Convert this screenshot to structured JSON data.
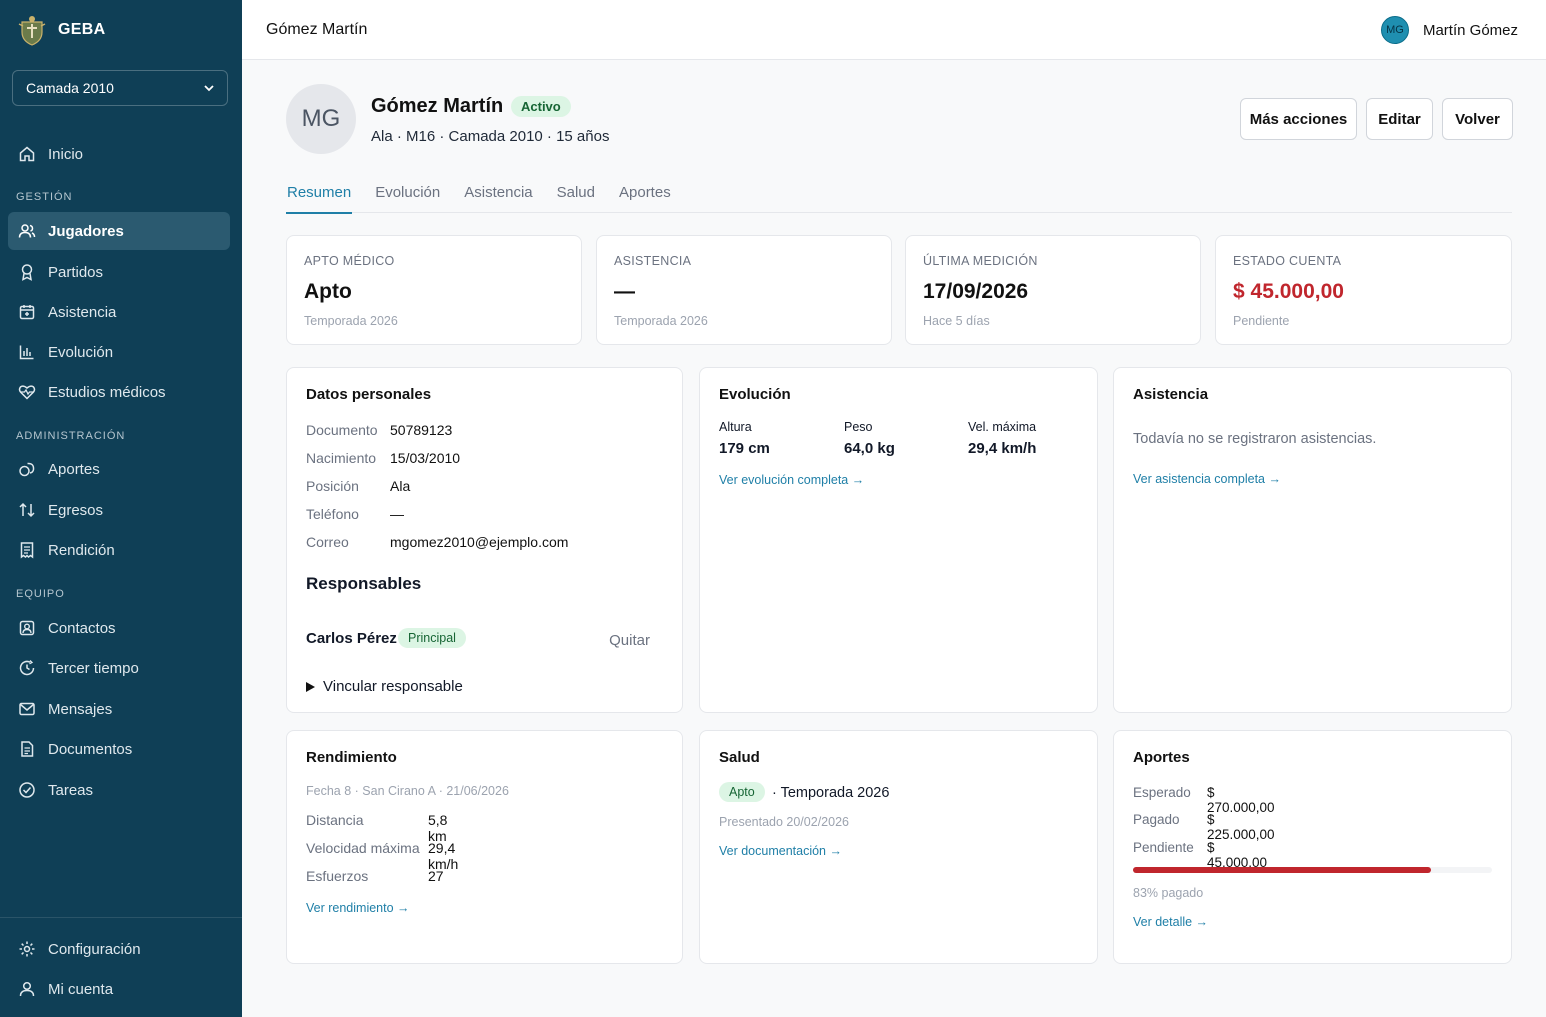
{
  "brand": {
    "name": "GEBA"
  },
  "sidebar": {
    "selector": "Camada 2010",
    "inicio": "Inicio",
    "sections": {
      "gestion": "GESTIÓN",
      "administracion": "ADMINISTRACIÓN",
      "equipo": "EQUIPO"
    },
    "gestion_items": [
      "Jugadores",
      "Partidos",
      "Asistencia",
      "Evolución",
      "Estudios médicos"
    ],
    "administracion_items": [
      "Aportes",
      "Egresos",
      "Rendición"
    ],
    "equipo_items": [
      "Contactos",
      "Tercer tiempo",
      "Mensajes",
      "Documentos",
      "Tareas"
    ],
    "footer_items": [
      "Configuración",
      "Mi cuenta"
    ]
  },
  "topbar": {
    "title": "Gómez Martín",
    "user_initials": "MG",
    "user_name": "Martín Gómez"
  },
  "player": {
    "initials": "MG",
    "name": "Gómez Martín",
    "status": "Activo",
    "subtitle": "Ala · M16 · Camada 2010 · 15 años"
  },
  "actions": {
    "more": "Más acciones",
    "edit": "Editar",
    "back": "Volver"
  },
  "tabs": [
    "Resumen",
    "Evolución",
    "Asistencia",
    "Salud",
    "Aportes"
  ],
  "stats": [
    {
      "label": "APTO MÉDICO",
      "value": "Apto",
      "sub": "Temporada 2026"
    },
    {
      "label": "ASISTENCIA",
      "value": "—",
      "sub": "Temporada 2026"
    },
    {
      "label": "ÚLTIMA MEDICIÓN",
      "value": "17/09/2026",
      "sub": "Hace 5 días"
    },
    {
      "label": "ESTADO CUENTA",
      "value": "$ 45.000,00",
      "sub": "Pendiente"
    }
  ],
  "personal": {
    "title": "Datos personales",
    "rows": [
      {
        "key": "Documento",
        "value": "50789123"
      },
      {
        "key": "Nacimiento",
        "value": "15/03/2010"
      },
      {
        "key": "Posición",
        "value": "Ala"
      },
      {
        "key": "Teléfono",
        "value": "—"
      },
      {
        "key": "Correo",
        "value": "mgomez2010@ejemplo.com"
      }
    ],
    "responsables_title": "Responsables",
    "responsable_name": "Carlos Pérez",
    "responsable_badge": "Principal",
    "remove": "Quitar",
    "link_responsable": "Vincular responsable"
  },
  "evolucion": {
    "title": "Evolución",
    "metrics": [
      {
        "label": "Altura",
        "value": "179 cm"
      },
      {
        "label": "Peso",
        "value": "64,0 kg"
      },
      {
        "label": "Vel. máxima",
        "value": "29,4 km/h"
      }
    ],
    "link": "Ver evolución completa →"
  },
  "asistencia": {
    "title": "Asistencia",
    "empty": "Todavía no se registraron asistencias.",
    "link": "Ver asistencia completa →"
  },
  "rendimiento": {
    "title": "Rendimiento",
    "match": "Fecha 8 · San Cirano A · 21/06/2026",
    "rows": [
      {
        "key": "Distancia",
        "value": "5,8 km"
      },
      {
        "key": "Velocidad máxima",
        "value": "29,4 km/h"
      },
      {
        "key": "Esfuerzos",
        "value": "27"
      }
    ],
    "link": "Ver rendimiento →"
  },
  "salud": {
    "title": "Salud",
    "badge": "Apto",
    "season": "· Temporada 2026",
    "presented": "Presentado 20/02/2026",
    "link": "Ver documentación →"
  },
  "aportes": {
    "title": "Aportes",
    "rows": [
      {
        "key": "Esperado",
        "value": "$ 270.000,00"
      },
      {
        "key": "Pagado",
        "value": "$ 225.000,00"
      },
      {
        "key": "Pendiente",
        "value": "$ 45.000,00"
      }
    ],
    "progress": 0.83,
    "progress_label": "83% pagado",
    "link": "Ver detalle →"
  },
  "colors": {
    "sidebar": "#0f3f56",
    "accent": "#1f7fa7",
    "danger": "#c0262d",
    "success_bg": "#dcf5e4"
  }
}
